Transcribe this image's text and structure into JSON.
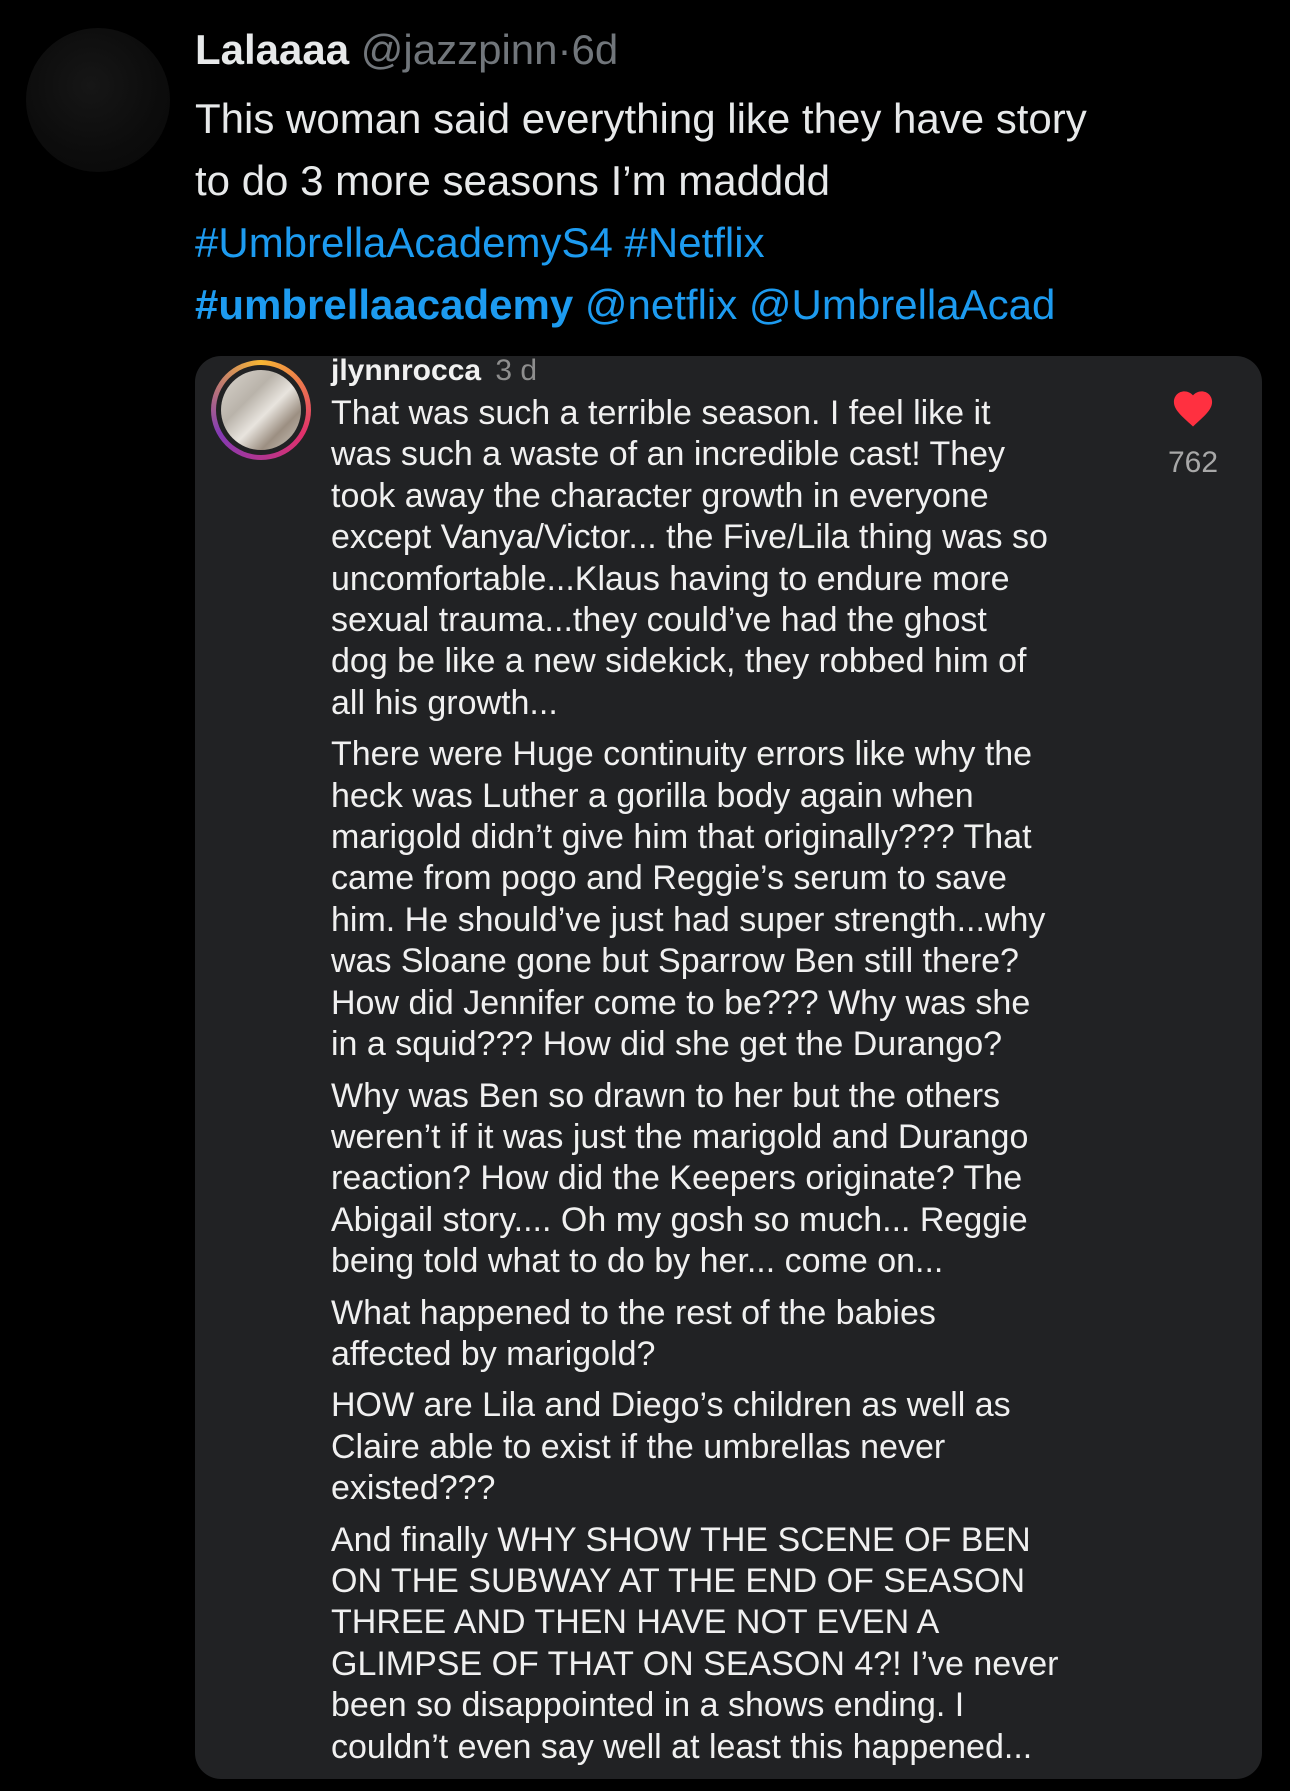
{
  "tweet": {
    "display_name": "Lalaaaa",
    "handle": "@jazzpinn",
    "separator": "·",
    "time": "6d",
    "text_lines": [
      "This woman said everything like they have story",
      "to do 3 more seasons I’m madddd"
    ],
    "hashtags_line1": [
      "#UmbrellaAcademyS4",
      "#Netflix"
    ],
    "hashtag_bold": "#umbrellaacademy",
    "mentions": [
      "@netflix",
      "@UmbrellaAcad"
    ]
  },
  "embed": {
    "username": "jlynnrocca",
    "time": "3 d",
    "like_count": "762",
    "heart_color": "#ff3040",
    "paragraphs": [
      [
        "That was such a terrible season. I feel like it",
        "was such a waste of an incredible cast! They",
        "took away the character growth in everyone",
        "except Vanya/Victor... the Five/Lila thing was so",
        "uncomfortable...Klaus having to endure more",
        "sexual trauma...they could’ve had the ghost",
        "dog be like a new sidekick, they robbed him of",
        "all his growth..."
      ],
      [
        "There were Huge continuity errors like why the",
        "heck was Luther a gorilla body again when",
        "marigold didn’t give him that originally??? That",
        "came from pogo and Reggie’s serum to save",
        "him. He should’ve just had super strength...why",
        "was Sloane gone but Sparrow Ben still there?",
        "How did Jennifer come to be??? Why was she",
        "in a squid??? How did she get the Durango?"
      ],
      [
        "Why was Ben so drawn to her but the others",
        "weren’t if it was just the marigold and Durango",
        "reaction? How did the Keepers originate? The",
        "Abigail story.... Oh my gosh so much... Reggie",
        "being told what to do by her... come on..."
      ],
      [
        "What happened to the rest of the babies",
        "affected by marigold?"
      ],
      [
        "HOW are Lila and Diego’s children as well as",
        "Claire able to exist if the umbrellas never",
        "existed???"
      ],
      [
        " And finally WHY SHOW THE SCENE OF BEN",
        "ON THE SUBWAY AT THE END OF SEASON",
        "THREE AND THEN HAVE NOT EVEN A",
        "GLIMPSE OF THAT ON SEASON 4?! I’ve never",
        "been so disappointed in a shows ending.  I",
        "couldn’t even say well at least this happened..."
      ]
    ]
  },
  "colors": {
    "background": "#000000",
    "link": "#1d9bf0",
    "embed_background": "#212224"
  }
}
